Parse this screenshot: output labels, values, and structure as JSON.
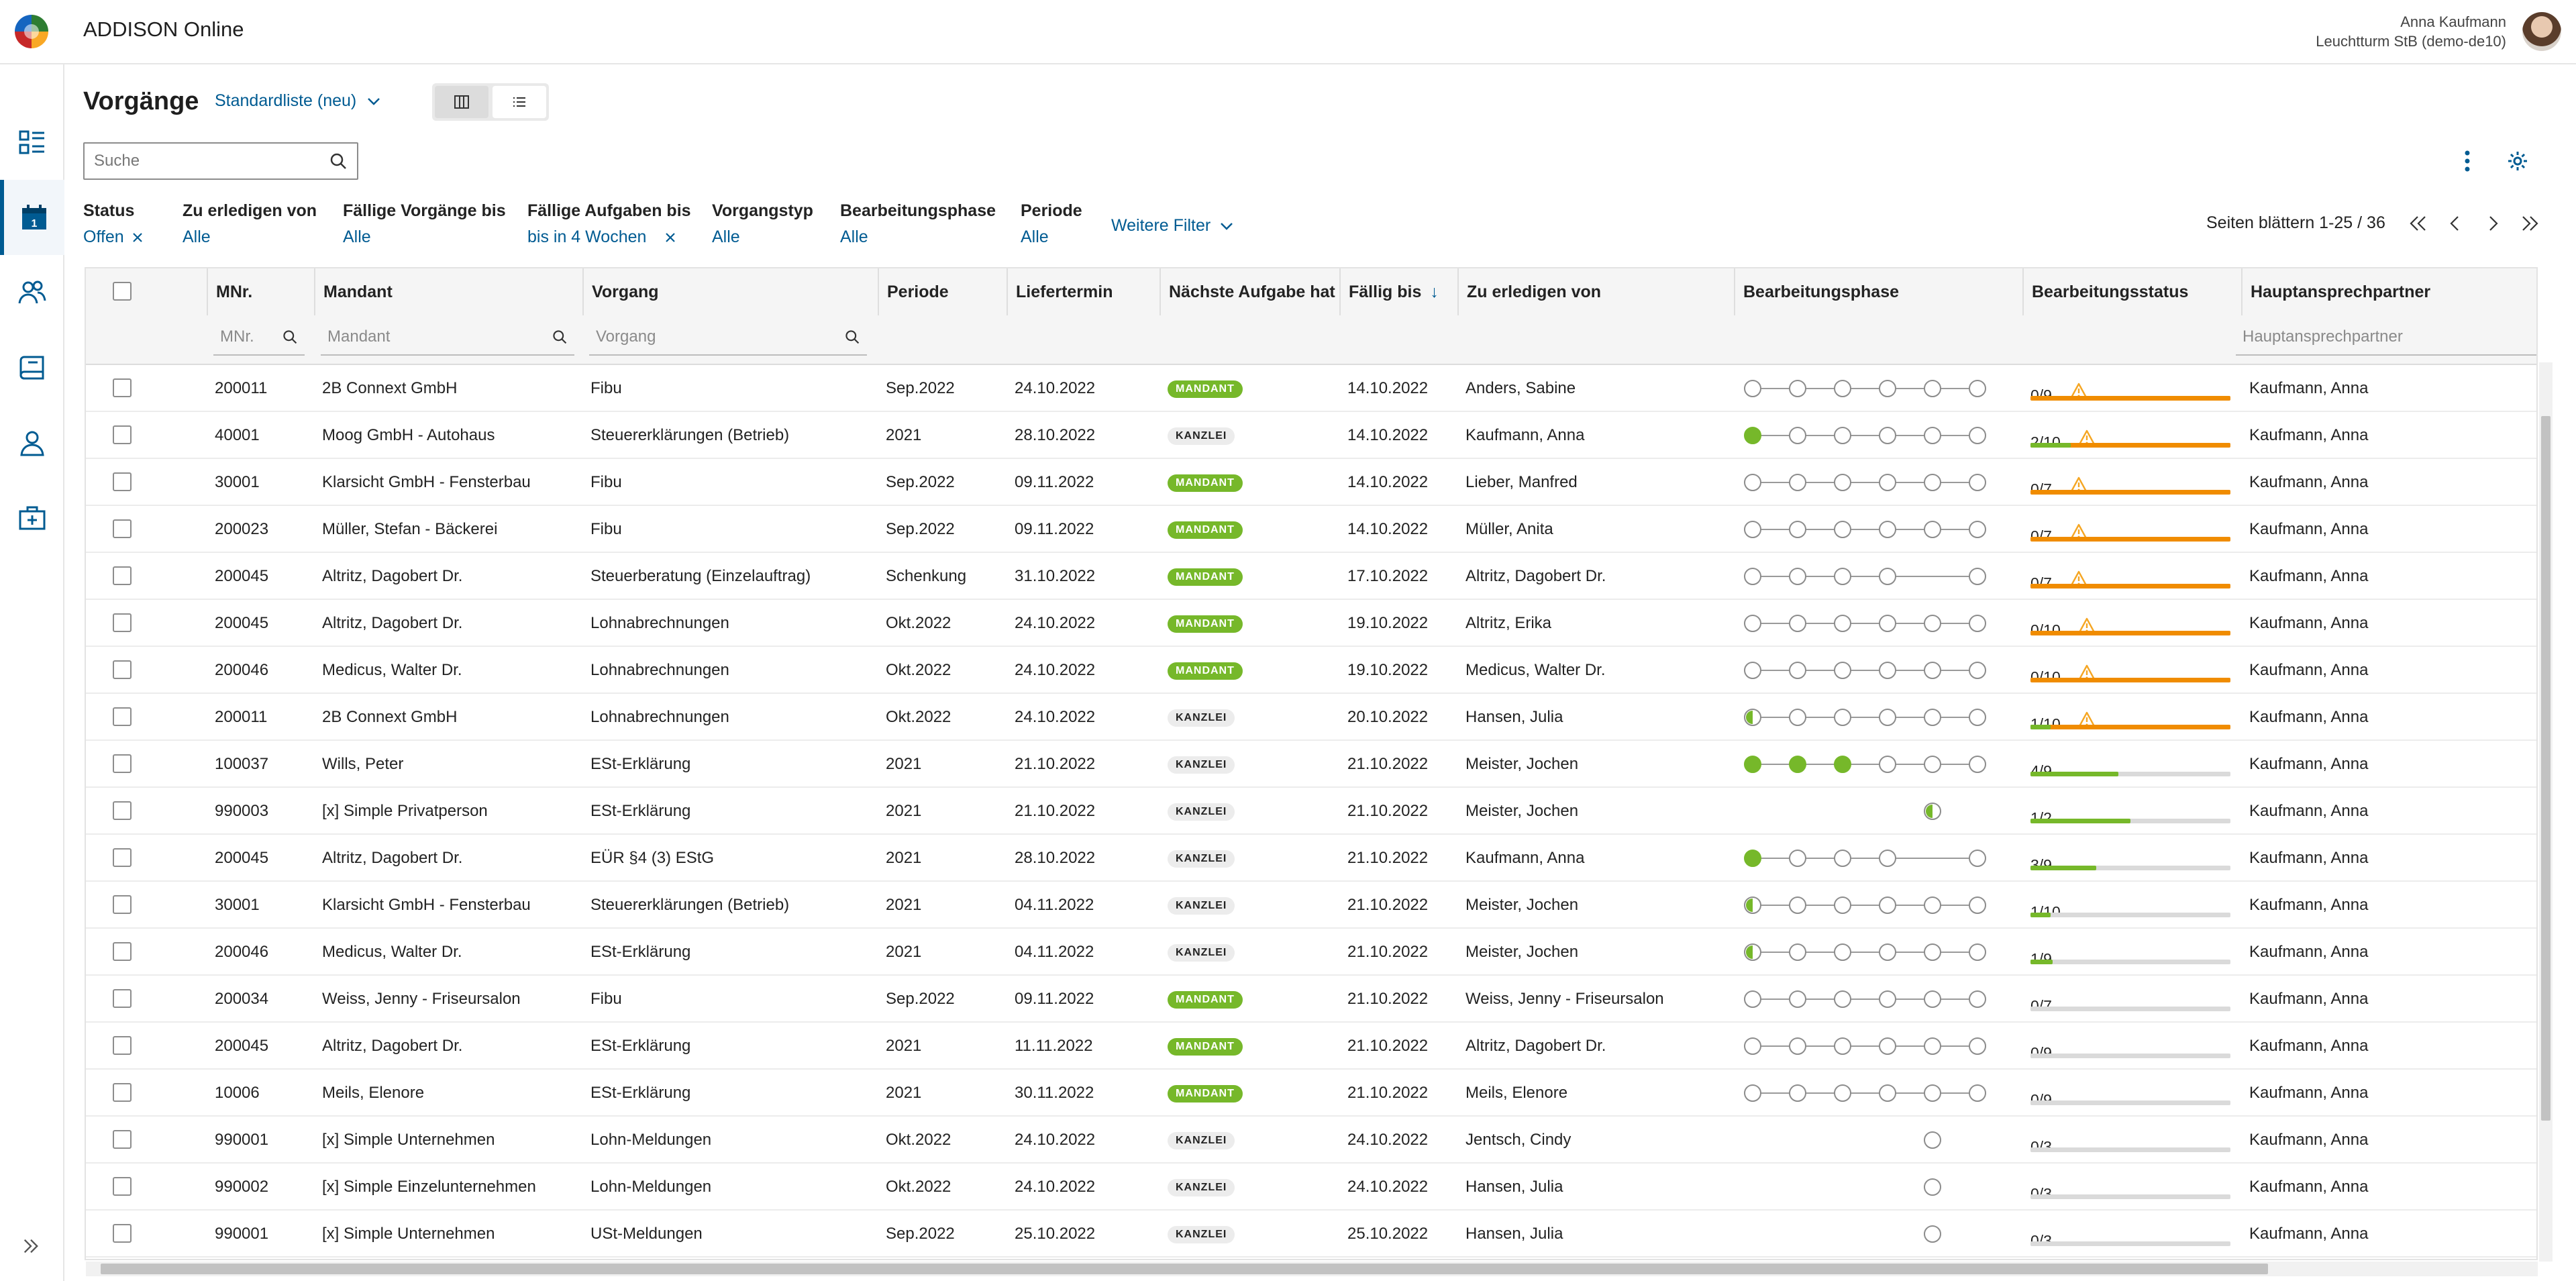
{
  "app": {
    "title": "ADDISON Online",
    "user_name": "Anna Kaufmann",
    "user_org": "Leuchtturm StB (demo-de10)"
  },
  "sidebar": {
    "items": [
      {
        "icon": "dashboard-icon",
        "active": false
      },
      {
        "icon": "calendar-icon",
        "active": true
      },
      {
        "icon": "contacts-icon",
        "active": false
      },
      {
        "icon": "book-icon",
        "active": false
      },
      {
        "icon": "person-icon",
        "active": false
      },
      {
        "icon": "medical-case-icon",
        "active": false
      }
    ],
    "expand_icon": "double-chevron-right-icon"
  },
  "header": {
    "title": "Vorgänge",
    "view_select": "Standardliste (neu)",
    "search_placeholder": "Suche"
  },
  "filters": [
    {
      "label": "Status",
      "value": "Offen",
      "removable": true
    },
    {
      "label": "Zu erledigen von",
      "value": "Alle",
      "removable": false
    },
    {
      "label": "Fällige Vorgänge bis",
      "value": "Alle",
      "removable": false
    },
    {
      "label": "Fällige Aufgaben bis",
      "value": "bis in 4 Wochen",
      "removable": true
    },
    {
      "label": "Vorgangstyp",
      "value": "Alle",
      "removable": false
    },
    {
      "label": "Bearbeitungsphase",
      "value": "Alle",
      "removable": false
    },
    {
      "label": "Periode",
      "value": "Alle",
      "removable": false
    }
  ],
  "more_filters": "Weitere Filter",
  "pager": {
    "text": "Seiten blättern 1-25 / 36"
  },
  "columns": {
    "mnr": "MNr.",
    "mandant": "Mandant",
    "vorgang": "Vorgang",
    "periode": "Periode",
    "liefertermin": "Liefertermin",
    "naechste": "Nächste Aufgabe hat",
    "faellig": "Fällig bis",
    "zu_erledigen": "Zu erledigen von",
    "phase": "Bearbeitungsphase",
    "status": "Bearbeitungsstatus",
    "ansprech": "Hauptansprechpartner"
  },
  "column_filters": {
    "mnr": "MNr.",
    "mandant": "Mandant",
    "vorgang": "Vorgang",
    "ansprech": "Hauptansprechpartner"
  },
  "colors": {
    "accent": "#005b92",
    "green": "#76b82a",
    "orange": "#f08c00",
    "warning": "#f5a623"
  },
  "rows": [
    {
      "mnr": "200011",
      "mandant": "2B Connext GmbH",
      "vorgang": "Fibu",
      "periode": "Sep.2022",
      "liefertermin": "24.10.2022",
      "naechste": "MANDANT",
      "faellig": "14.10.2022",
      "zu_erledigen": "Anders, Sabine",
      "phase": [
        "o",
        "o",
        "o",
        "o",
        "o",
        "o"
      ],
      "phase_gap": false,
      "status": "0/9",
      "progress": 1.0,
      "bar": "orange",
      "warning": true,
      "ansprech": "Kaufmann, Anna"
    },
    {
      "mnr": "40001",
      "mandant": "Moog GmbH - Autohaus",
      "vorgang": "Steuererklärungen (Betrieb)",
      "periode": "2021",
      "liefertermin": "28.10.2022",
      "naechste": "KANZLEI",
      "faellig": "14.10.2022",
      "zu_erledigen": "Kaufmann, Anna",
      "phase": [
        "f",
        "o",
        "o",
        "o",
        "o",
        "o"
      ],
      "phase_gap": false,
      "status": "2/10",
      "progress": 1.0,
      "bar": "orange",
      "green_part": 0.2,
      "warning": true,
      "ansprech": "Kaufmann, Anna"
    },
    {
      "mnr": "30001",
      "mandant": "Klarsicht GmbH - Fensterbau",
      "vorgang": "Fibu",
      "periode": "Sep.2022",
      "liefertermin": "09.11.2022",
      "naechste": "MANDANT",
      "faellig": "14.10.2022",
      "zu_erledigen": "Lieber, Manfred",
      "phase": [
        "o",
        "o",
        "o",
        "o",
        "o",
        "o"
      ],
      "phase_gap": false,
      "status": "0/7",
      "progress": 1.0,
      "bar": "orange",
      "warning": true,
      "ansprech": "Kaufmann, Anna"
    },
    {
      "mnr": "200023",
      "mandant": "Müller, Stefan - Bäckerei",
      "vorgang": "Fibu",
      "periode": "Sep.2022",
      "liefertermin": "09.11.2022",
      "naechste": "MANDANT",
      "faellig": "14.10.2022",
      "zu_erledigen": "Müller, Anita",
      "phase": [
        "o",
        "o",
        "o",
        "o",
        "o",
        "o"
      ],
      "phase_gap": false,
      "status": "0/7",
      "progress": 1.0,
      "bar": "orange",
      "warning": true,
      "ansprech": "Kaufmann, Anna"
    },
    {
      "mnr": "200045",
      "mandant": "Altritz, Dagobert Dr.",
      "vorgang": "Steuerberatung (Einzelauftrag)",
      "periode": "Schenkung",
      "liefertermin": "31.10.2022",
      "naechste": "MANDANT",
      "faellig": "17.10.2022",
      "zu_erledigen": "Altritz, Dagobert Dr.",
      "phase": [
        "o",
        "o",
        "o",
        "o",
        "-",
        "o"
      ],
      "phase_gap": true,
      "status": "0/7",
      "progress": 1.0,
      "bar": "orange",
      "warning": true,
      "ansprech": "Kaufmann, Anna"
    },
    {
      "mnr": "200045",
      "mandant": "Altritz, Dagobert Dr.",
      "vorgang": "Lohnabrechnungen",
      "periode": "Okt.2022",
      "liefertermin": "24.10.2022",
      "naechste": "MANDANT",
      "faellig": "19.10.2022",
      "zu_erledigen": "Altritz, Erika",
      "phase": [
        "o",
        "o",
        "o",
        "o",
        "o",
        "o"
      ],
      "phase_gap": false,
      "status": "0/10",
      "progress": 1.0,
      "bar": "orange",
      "warning": true,
      "ansprech": "Kaufmann, Anna"
    },
    {
      "mnr": "200046",
      "mandant": "Medicus, Walter Dr.",
      "vorgang": "Lohnabrechnungen",
      "periode": "Okt.2022",
      "liefertermin": "24.10.2022",
      "naechste": "MANDANT",
      "faellig": "19.10.2022",
      "zu_erledigen": "Medicus, Walter Dr.",
      "phase": [
        "o",
        "o",
        "o",
        "o",
        "o",
        "o"
      ],
      "phase_gap": false,
      "status": "0/10",
      "progress": 1.0,
      "bar": "orange",
      "warning": true,
      "ansprech": "Kaufmann, Anna"
    },
    {
      "mnr": "200011",
      "mandant": "2B Connext GmbH",
      "vorgang": "Lohnabrechnungen",
      "periode": "Okt.2022",
      "liefertermin": "24.10.2022",
      "naechste": "KANZLEI",
      "faellig": "20.10.2022",
      "zu_erledigen": "Hansen, Julia",
      "phase": [
        "h",
        "o",
        "o",
        "o",
        "o",
        "o"
      ],
      "phase_gap": false,
      "status": "1/10",
      "progress": 1.0,
      "bar": "orange",
      "green_part": 0.1,
      "warning": true,
      "ansprech": "Kaufmann, Anna"
    },
    {
      "mnr": "100037",
      "mandant": "Wills, Peter",
      "vorgang": "ESt-Erklärung",
      "periode": "2021",
      "liefertermin": "21.10.2022",
      "naechste": "KANZLEI",
      "faellig": "21.10.2022",
      "zu_erledigen": "Meister, Jochen",
      "phase": [
        "f",
        "f",
        "f",
        "o",
        "o",
        "o"
      ],
      "phase_gap": false,
      "status": "4/9",
      "progress": 0.44,
      "bar": "green",
      "warning": false,
      "ansprech": "Kaufmann, Anna"
    },
    {
      "mnr": "990003",
      "mandant": "[x] Simple Privatperson",
      "vorgang": "ESt-Erklärung",
      "periode": "2021",
      "liefertermin": "21.10.2022",
      "naechste": "KANZLEI",
      "faellig": "21.10.2022",
      "zu_erledigen": "Meister, Jochen",
      "phase": [
        "-",
        "-",
        "-",
        "-",
        "h",
        "-"
      ],
      "phase_gap": false,
      "status": "1/2",
      "progress": 0.5,
      "bar": "green",
      "warning": false,
      "ansprech": "Kaufmann, Anna"
    },
    {
      "mnr": "200045",
      "mandant": "Altritz, Dagobert Dr.",
      "vorgang": "EÜR §4 (3) EStG",
      "periode": "2021",
      "liefertermin": "28.10.2022",
      "naechste": "KANZLEI",
      "faellig": "21.10.2022",
      "zu_erledigen": "Kaufmann, Anna",
      "phase": [
        "f",
        "o",
        "o",
        "o",
        "-",
        "o"
      ],
      "phase_gap": true,
      "status": "3/9",
      "progress": 0.33,
      "bar": "green",
      "warning": false,
      "ansprech": "Kaufmann, Anna"
    },
    {
      "mnr": "30001",
      "mandant": "Klarsicht GmbH - Fensterbau",
      "vorgang": "Steuererklärungen (Betrieb)",
      "periode": "2021",
      "liefertermin": "04.11.2022",
      "naechste": "KANZLEI",
      "faellig": "21.10.2022",
      "zu_erledigen": "Meister, Jochen",
      "phase": [
        "h",
        "o",
        "o",
        "o",
        "o",
        "o"
      ],
      "phase_gap": false,
      "status": "1/10",
      "progress": 0.1,
      "bar": "green",
      "warning": false,
      "ansprech": "Kaufmann, Anna"
    },
    {
      "mnr": "200046",
      "mandant": "Medicus, Walter Dr.",
      "vorgang": "ESt-Erklärung",
      "periode": "2021",
      "liefertermin": "04.11.2022",
      "naechste": "KANZLEI",
      "faellig": "21.10.2022",
      "zu_erledigen": "Meister, Jochen",
      "phase": [
        "h",
        "o",
        "o",
        "o",
        "o",
        "o"
      ],
      "phase_gap": false,
      "status": "1/9",
      "progress": 0.11,
      "bar": "green",
      "warning": false,
      "ansprech": "Kaufmann, Anna"
    },
    {
      "mnr": "200034",
      "mandant": "Weiss, Jenny - Friseursalon",
      "vorgang": "Fibu",
      "periode": "Sep.2022",
      "liefertermin": "09.11.2022",
      "naechste": "MANDANT",
      "faellig": "21.10.2022",
      "zu_erledigen": "Weiss, Jenny - Friseursalon",
      "phase": [
        "o",
        "o",
        "o",
        "o",
        "o",
        "o"
      ],
      "phase_gap": false,
      "status": "0/7",
      "progress": 0,
      "bar": "green",
      "warning": false,
      "ansprech": "Kaufmann, Anna"
    },
    {
      "mnr": "200045",
      "mandant": "Altritz, Dagobert Dr.",
      "vorgang": "ESt-Erklärung",
      "periode": "2021",
      "liefertermin": "11.11.2022",
      "naechste": "MANDANT",
      "faellig": "21.10.2022",
      "zu_erledigen": "Altritz, Dagobert Dr.",
      "phase": [
        "o",
        "o",
        "o",
        "o",
        "o",
        "o"
      ],
      "phase_gap": false,
      "status": "0/9",
      "progress": 0,
      "bar": "green",
      "warning": false,
      "ansprech": "Kaufmann, Anna"
    },
    {
      "mnr": "10006",
      "mandant": "Meils, Elenore",
      "vorgang": "ESt-Erklärung",
      "periode": "2021",
      "liefertermin": "30.11.2022",
      "naechste": "MANDANT",
      "faellig": "21.10.2022",
      "zu_erledigen": "Meils, Elenore",
      "phase": [
        "o",
        "o",
        "o",
        "o",
        "o",
        "o"
      ],
      "phase_gap": false,
      "status": "0/9",
      "progress": 0,
      "bar": "green",
      "warning": false,
      "ansprech": "Kaufmann, Anna"
    },
    {
      "mnr": "990001",
      "mandant": "[x] Simple Unternehmen",
      "vorgang": "Lohn-Meldungen",
      "periode": "Okt.2022",
      "liefertermin": "24.10.2022",
      "naechste": "KANZLEI",
      "faellig": "24.10.2022",
      "zu_erledigen": "Jentsch, Cindy",
      "phase": [
        "-",
        "-",
        "-",
        "-",
        "o",
        "-"
      ],
      "phase_gap": false,
      "status": "0/3",
      "progress": 0,
      "bar": "green",
      "warning": false,
      "ansprech": "Kaufmann, Anna"
    },
    {
      "mnr": "990002",
      "mandant": "[x] Simple Einzelunternehmen",
      "vorgang": "Lohn-Meldungen",
      "periode": "Okt.2022",
      "liefertermin": "24.10.2022",
      "naechste": "KANZLEI",
      "faellig": "24.10.2022",
      "zu_erledigen": "Hansen, Julia",
      "phase": [
        "-",
        "-",
        "-",
        "-",
        "o",
        "-"
      ],
      "phase_gap": false,
      "status": "0/3",
      "progress": 0,
      "bar": "green",
      "warning": false,
      "ansprech": "Kaufmann, Anna"
    },
    {
      "mnr": "990001",
      "mandant": "[x] Simple Unternehmen",
      "vorgang": "USt-Meldungen",
      "periode": "Sep.2022",
      "liefertermin": "25.10.2022",
      "naechste": "KANZLEI",
      "faellig": "25.10.2022",
      "zu_erledigen": "Hansen, Julia",
      "phase": [
        "-",
        "-",
        "-",
        "-",
        "o",
        "-"
      ],
      "phase_gap": false,
      "status": "0/3",
      "progress": 0,
      "bar": "green",
      "warning": false,
      "ansprech": "Kaufmann, Anna"
    }
  ]
}
